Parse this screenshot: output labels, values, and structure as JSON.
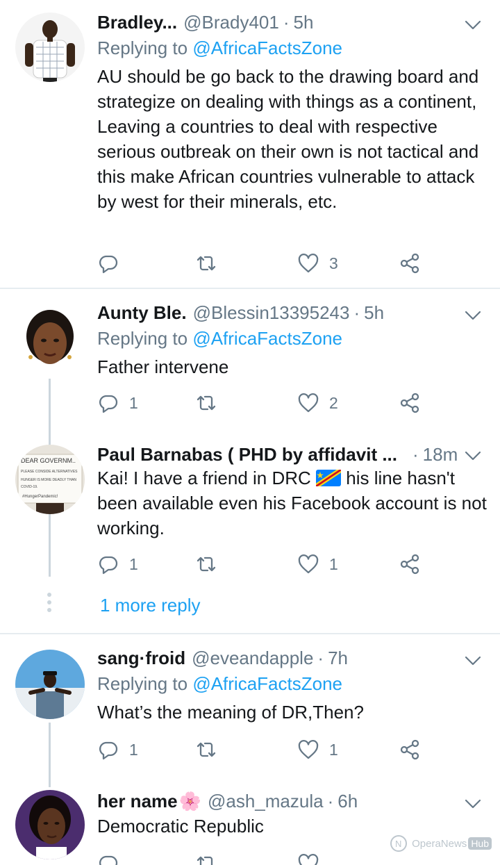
{
  "tweets": [
    {
      "name": "Bradley...",
      "handle": "@Brady401",
      "dot": "·",
      "time": "5h",
      "replying_prefix": "Replying to",
      "replying_to": "@AfricaFactsZone",
      "text": "AU should be go back to the drawing board and strategize on dealing with things as a continent, Leaving a countries to deal with respective serious outbreak on their own is not tactical and this make African countries vulnerable to attack by west for their minerals, etc.",
      "replies": "",
      "retweets": "",
      "likes": "3"
    },
    {
      "name": "Aunty Ble.",
      "handle": "@Blessin13395243",
      "dot": "·",
      "time": "5h",
      "replying_prefix": "Replying to",
      "replying_to": "@AfricaFactsZone",
      "text": "Father intervene",
      "replies": "1",
      "retweets": "",
      "likes": "2"
    },
    {
      "name": "Paul Barnabas ( PHD by affidavit ...",
      "handle": "",
      "dot": "·",
      "time": "18m",
      "text_before_flag": "Kai!  I have a friend in DRC ",
      "text_after_flag": " his line hasn't been available even his Facebook account is not working.",
      "replies": "1",
      "retweets": "",
      "likes": "1"
    },
    {
      "name": "sang·froid",
      "handle": "@eveandapple",
      "dot": "·",
      "time": "7h",
      "replying_prefix": "Replying to",
      "replying_to": "@AfricaFactsZone",
      "text": "What’s the meaning of DR,Then?",
      "replies": "1",
      "retweets": "",
      "likes": "1"
    },
    {
      "name": "her name",
      "name_emoji": "🌸",
      "handle": "@ash_mazula",
      "dot": "·",
      "time": "6h",
      "text": "Democratic Republic"
    }
  ],
  "more_reply": "1 more reply",
  "avatar_sign_lines": [
    "DEAR GOVERNM..",
    "PLEASE CONSIDE ALTERNATIVES",
    "HUNGER IS MORE DEADLY THAN",
    "COVID-19.",
    "#HungerPandemic!"
  ],
  "watermark": {
    "text": "OperaNews",
    "hub": "Hub"
  },
  "colors": {
    "accent": "#1da1f2",
    "muted": "#657786",
    "text": "#14171a",
    "divider": "#e6ecf0",
    "thread_line": "#ccd6dd"
  },
  "icons": [
    "reply-icon",
    "retweet-icon",
    "like-icon",
    "share-icon",
    "chevron-down-icon"
  ]
}
